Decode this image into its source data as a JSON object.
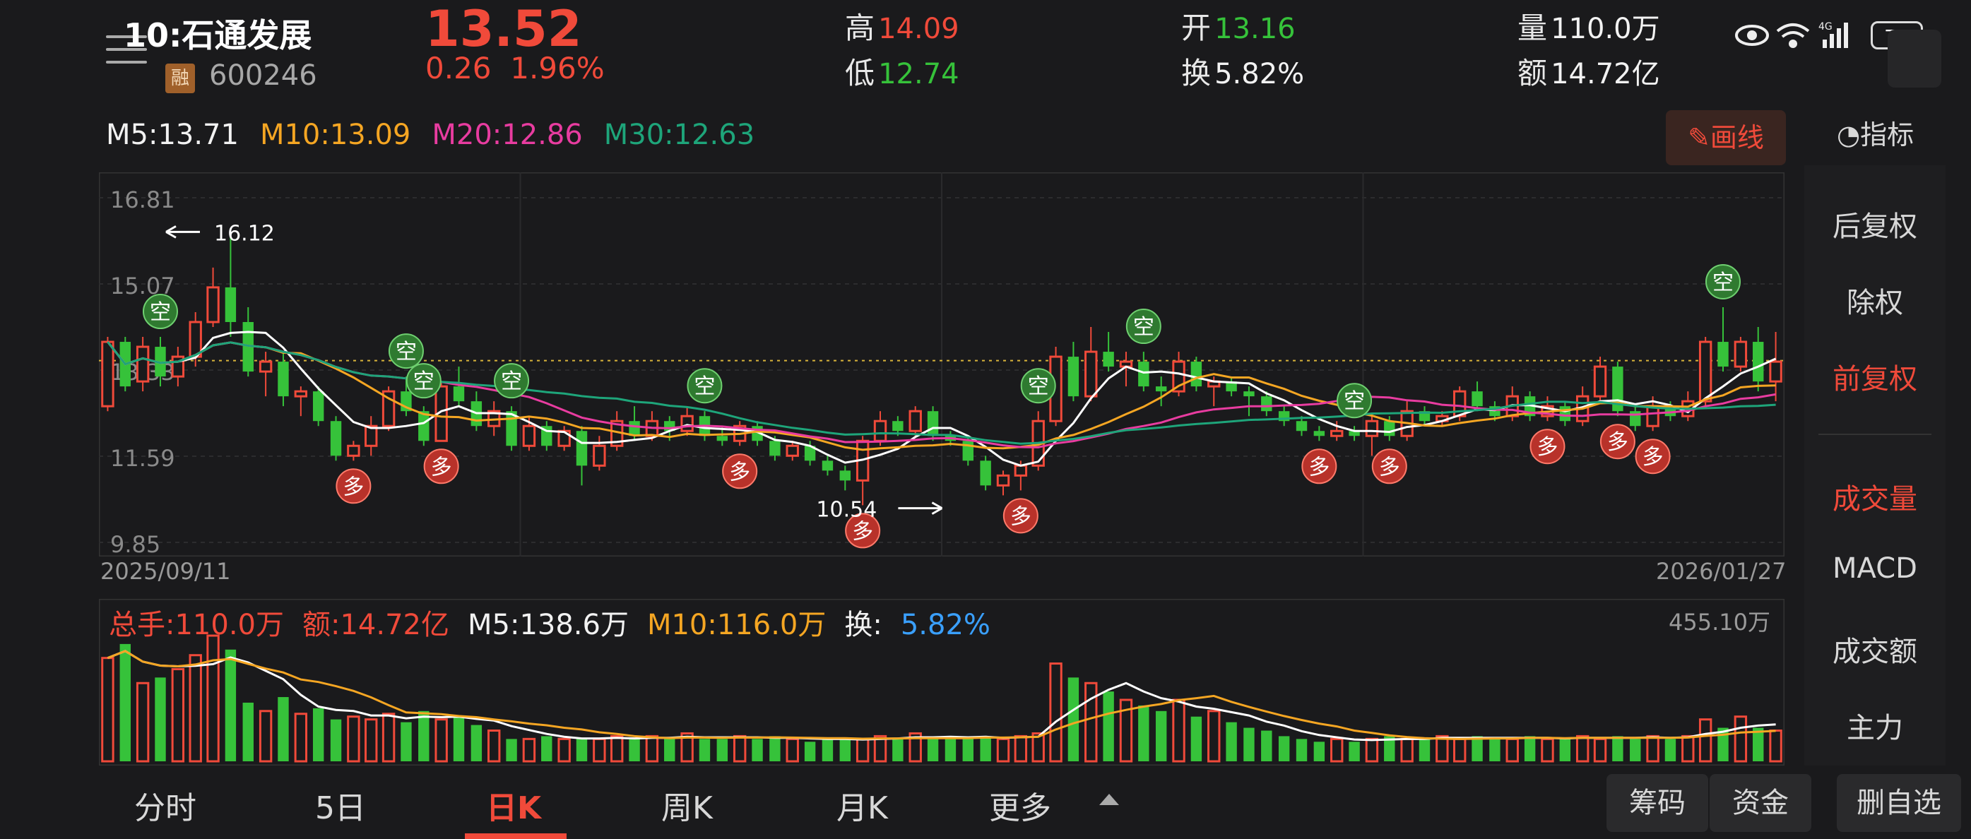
{
  "header": {
    "time": "10:",
    "stock_name": "石通发展",
    "rong": "融",
    "code": "600246",
    "price": "13.52",
    "change": "0.26",
    "change_pct": "1.96%",
    "high_label": "高",
    "high_value": "14.09",
    "low_label": "低",
    "low_value": "12.74",
    "open_label": "开",
    "open_value": "13.16",
    "turnover_label": "换",
    "turnover_value": "5.82%",
    "volume_label": "量",
    "volume_value": "110.0万",
    "amount_label": "额",
    "amount_value": "14.72亿"
  },
  "status": {
    "battery": "74"
  },
  "ma": {
    "m5": "M5:13.71",
    "m10": "M10:13.09",
    "m20": "M20:12.86",
    "m30": "M30:12.63"
  },
  "draw_button": "画线",
  "indicator_button": "指标",
  "chart_labels": {
    "y_ticks": [
      "16.81",
      "15.07",
      "13.33",
      "11.59",
      "9.85"
    ],
    "high_marker": "16.12",
    "low_marker": "10.54",
    "date_start": "2025/09/11",
    "date_end": "2026/01/27",
    "bull_tag": "多",
    "bear_tag": "空"
  },
  "volume": {
    "total": "总手:110.0万",
    "amount": "额:14.72亿",
    "m5": "M5:138.6万",
    "m10": "M10:116.0万",
    "turnover_label": "换:",
    "turnover": "5.82%",
    "max": "455.10万"
  },
  "right_panel": {
    "options": [
      "后复权",
      "除权",
      "前复权",
      "成交量",
      "MACD",
      "成交额",
      "主力"
    ],
    "active": [
      "前复权",
      "成交量"
    ]
  },
  "tabs": [
    "分时",
    "5日",
    "日K",
    "周K",
    "月K",
    "更多"
  ],
  "active_tab": "日K",
  "buttons": {
    "chips": "筹码",
    "funds": "资金",
    "remove": "删自选"
  },
  "colors": {
    "up": "#f04a3a",
    "down": "#36c23a",
    "m5": "#ffffff",
    "m10": "#f5a623",
    "m20": "#e83ca0",
    "m30": "#1ea57a"
  },
  "chart_data": {
    "type": "candlestick",
    "y_range": [
      9.85,
      16.81
    ],
    "candles": [
      [
        12.6,
        13.9,
        14.0,
        12.5
      ],
      [
        13.9,
        13.0,
        14.0,
        12.9
      ],
      [
        13.1,
        13.8,
        14.0,
        12.9
      ],
      [
        13.8,
        13.2,
        14.0,
        13.0
      ],
      [
        13.2,
        13.6,
        13.8,
        13.0
      ],
      [
        13.6,
        14.3,
        14.5,
        13.4
      ],
      [
        14.3,
        15.0,
        15.4,
        14.2
      ],
      [
        15.0,
        14.3,
        16.0,
        14.0
      ],
      [
        14.3,
        13.3,
        14.6,
        13.2
      ],
      [
        13.3,
        13.5,
        13.7,
        12.8
      ],
      [
        13.5,
        12.8,
        13.7,
        12.6
      ],
      [
        12.8,
        12.9,
        13.0,
        12.4
      ],
      [
        12.9,
        12.3,
        13.0,
        12.2
      ],
      [
        12.3,
        11.6,
        12.4,
        11.5
      ],
      [
        11.6,
        11.8,
        11.9,
        11.5
      ],
      [
        11.8,
        12.2,
        12.4,
        11.6
      ],
      [
        12.2,
        12.9,
        13.0,
        12.1
      ],
      [
        12.9,
        12.5,
        13.2,
        12.4
      ],
      [
        12.5,
        11.9,
        12.6,
        11.8
      ],
      [
        11.9,
        13.0,
        13.1,
        11.9
      ],
      [
        13.0,
        12.7,
        13.4,
        12.6
      ],
      [
        12.7,
        12.2,
        12.9,
        12.1
      ],
      [
        12.2,
        12.5,
        12.7,
        12.0
      ],
      [
        12.5,
        11.8,
        12.6,
        11.7
      ],
      [
        11.8,
        12.2,
        12.4,
        11.7
      ],
      [
        12.2,
        11.8,
        12.3,
        11.7
      ],
      [
        11.8,
        12.1,
        12.2,
        11.7
      ],
      [
        12.1,
        11.4,
        12.2,
        11.0
      ],
      [
        11.4,
        11.8,
        12.0,
        11.3
      ],
      [
        11.8,
        12.3,
        12.5,
        11.7
      ],
      [
        12.3,
        12.0,
        12.6,
        11.9
      ],
      [
        12.0,
        12.3,
        12.5,
        11.9
      ],
      [
        12.3,
        12.1,
        12.4,
        11.9
      ],
      [
        12.1,
        12.4,
        12.6,
        12.0
      ],
      [
        12.4,
        12.0,
        12.5,
        11.9
      ],
      [
        12.0,
        11.9,
        12.2,
        11.8
      ],
      [
        11.9,
        12.2,
        12.3,
        11.8
      ],
      [
        12.2,
        11.9,
        12.3,
        11.8
      ],
      [
        11.9,
        11.6,
        12.0,
        11.5
      ],
      [
        11.6,
        11.8,
        11.9,
        11.5
      ],
      [
        11.8,
        11.5,
        11.9,
        11.4
      ],
      [
        11.5,
        11.3,
        11.6,
        11.2
      ],
      [
        11.3,
        11.1,
        11.4,
        10.9
      ],
      [
        11.1,
        11.9,
        12.0,
        10.6
      ],
      [
        11.9,
        12.3,
        12.5,
        11.8
      ],
      [
        12.3,
        12.1,
        12.4,
        12.0
      ],
      [
        12.1,
        12.5,
        12.6,
        12.0
      ],
      [
        12.5,
        12.0,
        12.6,
        11.9
      ],
      [
        12.0,
        11.9,
        12.1,
        11.8
      ],
      [
        11.9,
        11.5,
        12.0,
        11.4
      ],
      [
        11.5,
        11.0,
        11.6,
        10.9
      ],
      [
        11.0,
        11.2,
        11.3,
        10.8
      ],
      [
        11.2,
        11.4,
        11.5,
        10.9
      ],
      [
        11.4,
        12.3,
        12.5,
        11.3
      ],
      [
        12.3,
        13.6,
        13.8,
        12.2
      ],
      [
        13.6,
        12.8,
        13.9,
        12.7
      ],
      [
        12.8,
        13.7,
        14.2,
        12.7
      ],
      [
        13.7,
        13.4,
        14.1,
        13.3
      ],
      [
        13.4,
        13.5,
        13.7,
        13.0
      ],
      [
        13.5,
        13.0,
        13.7,
        12.9
      ],
      [
        13.0,
        12.9,
        13.2,
        12.6
      ],
      [
        12.9,
        13.5,
        13.7,
        12.8
      ],
      [
        13.5,
        13.0,
        13.6,
        12.9
      ],
      [
        13.0,
        13.1,
        13.2,
        12.6
      ],
      [
        13.1,
        12.9,
        13.2,
        12.8
      ],
      [
        12.9,
        12.8,
        13.0,
        12.4
      ],
      [
        12.8,
        12.5,
        12.9,
        12.4
      ],
      [
        12.5,
        12.3,
        12.6,
        12.2
      ],
      [
        12.3,
        12.1,
        12.4,
        12.0
      ],
      [
        12.1,
        12.0,
        12.2,
        11.9
      ],
      [
        12.0,
        12.1,
        12.3,
        11.9
      ],
      [
        12.1,
        12.0,
        12.2,
        11.9
      ],
      [
        12.0,
        12.3,
        12.4,
        11.6
      ],
      [
        12.3,
        12.0,
        12.4,
        11.9
      ],
      [
        12.0,
        12.5,
        12.7,
        11.9
      ],
      [
        12.5,
        12.3,
        12.6,
        12.2
      ],
      [
        12.3,
        12.4,
        12.5,
        12.2
      ],
      [
        12.4,
        12.9,
        13.0,
        12.3
      ],
      [
        12.9,
        12.6,
        13.1,
        12.5
      ],
      [
        12.6,
        12.4,
        12.7,
        12.3
      ],
      [
        12.4,
        12.8,
        13.0,
        12.3
      ],
      [
        12.8,
        12.4,
        12.9,
        12.3
      ],
      [
        12.4,
        12.6,
        12.8,
        12.3
      ],
      [
        12.6,
        12.3,
        12.7,
        12.2
      ],
      [
        12.3,
        12.8,
        13.0,
        12.2
      ],
      [
        12.8,
        13.4,
        13.6,
        12.7
      ],
      [
        13.4,
        12.5,
        13.5,
        12.4
      ],
      [
        12.5,
        12.2,
        12.6,
        12.1
      ],
      [
        12.2,
        12.6,
        12.8,
        12.1
      ],
      [
        12.6,
        12.4,
        12.7,
        12.3
      ],
      [
        12.4,
        12.7,
        12.9,
        12.3
      ],
      [
        12.7,
        13.9,
        14.0,
        12.6
      ],
      [
        13.9,
        13.4,
        14.6,
        13.3
      ],
      [
        13.4,
        13.9,
        14.0,
        13.3
      ],
      [
        13.9,
        13.1,
        14.2,
        12.9
      ],
      [
        13.1,
        13.5,
        14.1,
        12.7
      ]
    ],
    "volume_max_wan": 455.1,
    "volumes": [
      370,
      420,
      280,
      300,
      330,
      380,
      450,
      400,
      210,
      180,
      230,
      170,
      190,
      150,
      160,
      150,
      170,
      140,
      180,
      150,
      160,
      130,
      110,
      80,
      80,
      90,
      80,
      80,
      80,
      90,
      80,
      90,
      80,
      100,
      80,
      80,
      90,
      80,
      90,
      80,
      70,
      80,
      80,
      80,
      90,
      80,
      100,
      80,
      90,
      80,
      90,
      80,
      90,
      100,
      350,
      300,
      280,
      250,
      220,
      200,
      180,
      220,
      160,
      180,
      140,
      120,
      110,
      90,
      80,
      70,
      80,
      70,
      80,
      90,
      80,
      80,
      90,
      80,
      90,
      80,
      80,
      90,
      80,
      80,
      90,
      80,
      90,
      80,
      90,
      80,
      90,
      150,
      120,
      160,
      120,
      110
    ],
    "bear_signals": [
      3,
      17,
      18,
      23,
      34,
      53,
      59,
      71,
      92
    ],
    "bull_signals": [
      14,
      19,
      36,
      43,
      52,
      69,
      73,
      82,
      86,
      88
    ]
  }
}
